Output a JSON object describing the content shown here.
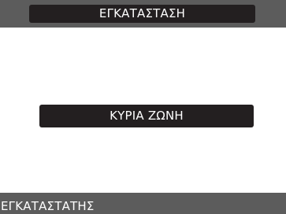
{
  "header": {
    "title": "ΕΓΚΑΤΑΣΤΑΣΗ"
  },
  "main": {
    "zone_button_label": "ΚΥΡΙΑ ΖΩΝΗ"
  },
  "footer": {
    "user_role": "ΕΓΚΑΤΑΣΤΑΤΗΣ"
  },
  "colors": {
    "bar_background": "#5c5c5c",
    "pill_background": "#231f20",
    "content_background": "#ffffff",
    "text_light": "#ffffff"
  }
}
